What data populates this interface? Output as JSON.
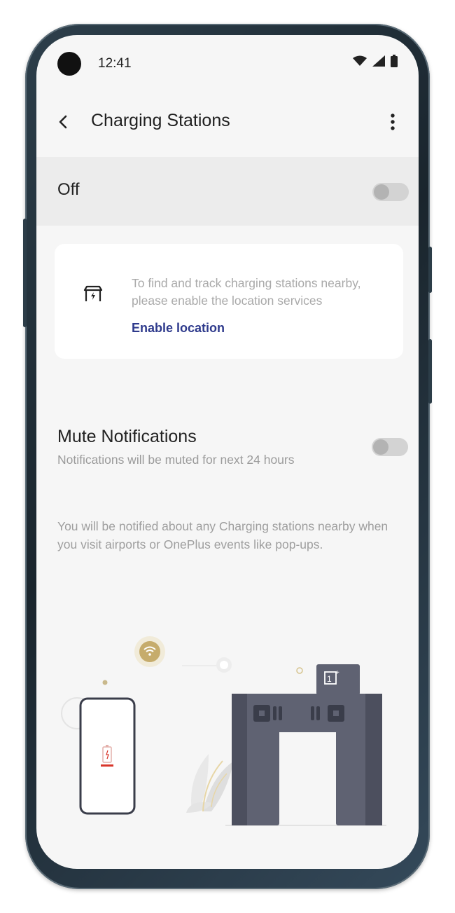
{
  "status_bar": {
    "time": "12:41",
    "icons": [
      "wifi-icon",
      "signal-icon",
      "battery-icon"
    ]
  },
  "app_bar": {
    "title": "Charging Stations",
    "back_icon": "back-arrow-icon",
    "more_icon": "more-vert-icon"
  },
  "main_toggle": {
    "label": "Off",
    "enabled": false
  },
  "location_card": {
    "icon": "charging-station-icon",
    "text": "To find and track charging stations nearby, please enable the location services",
    "link": "Enable location"
  },
  "mute": {
    "title": "Mute Notifications",
    "subtitle": "Notifications will be muted for next 24 hours",
    "enabled": false
  },
  "info_text": "You will be notified about any Charging stations nearby when you visit airports or OnePlus events like pop-ups.",
  "colors": {
    "link": "#2e3a8c",
    "kiosk": "#5f6272",
    "battery_low": "#d9362b",
    "wifi_badge": "#c6ac6c"
  }
}
